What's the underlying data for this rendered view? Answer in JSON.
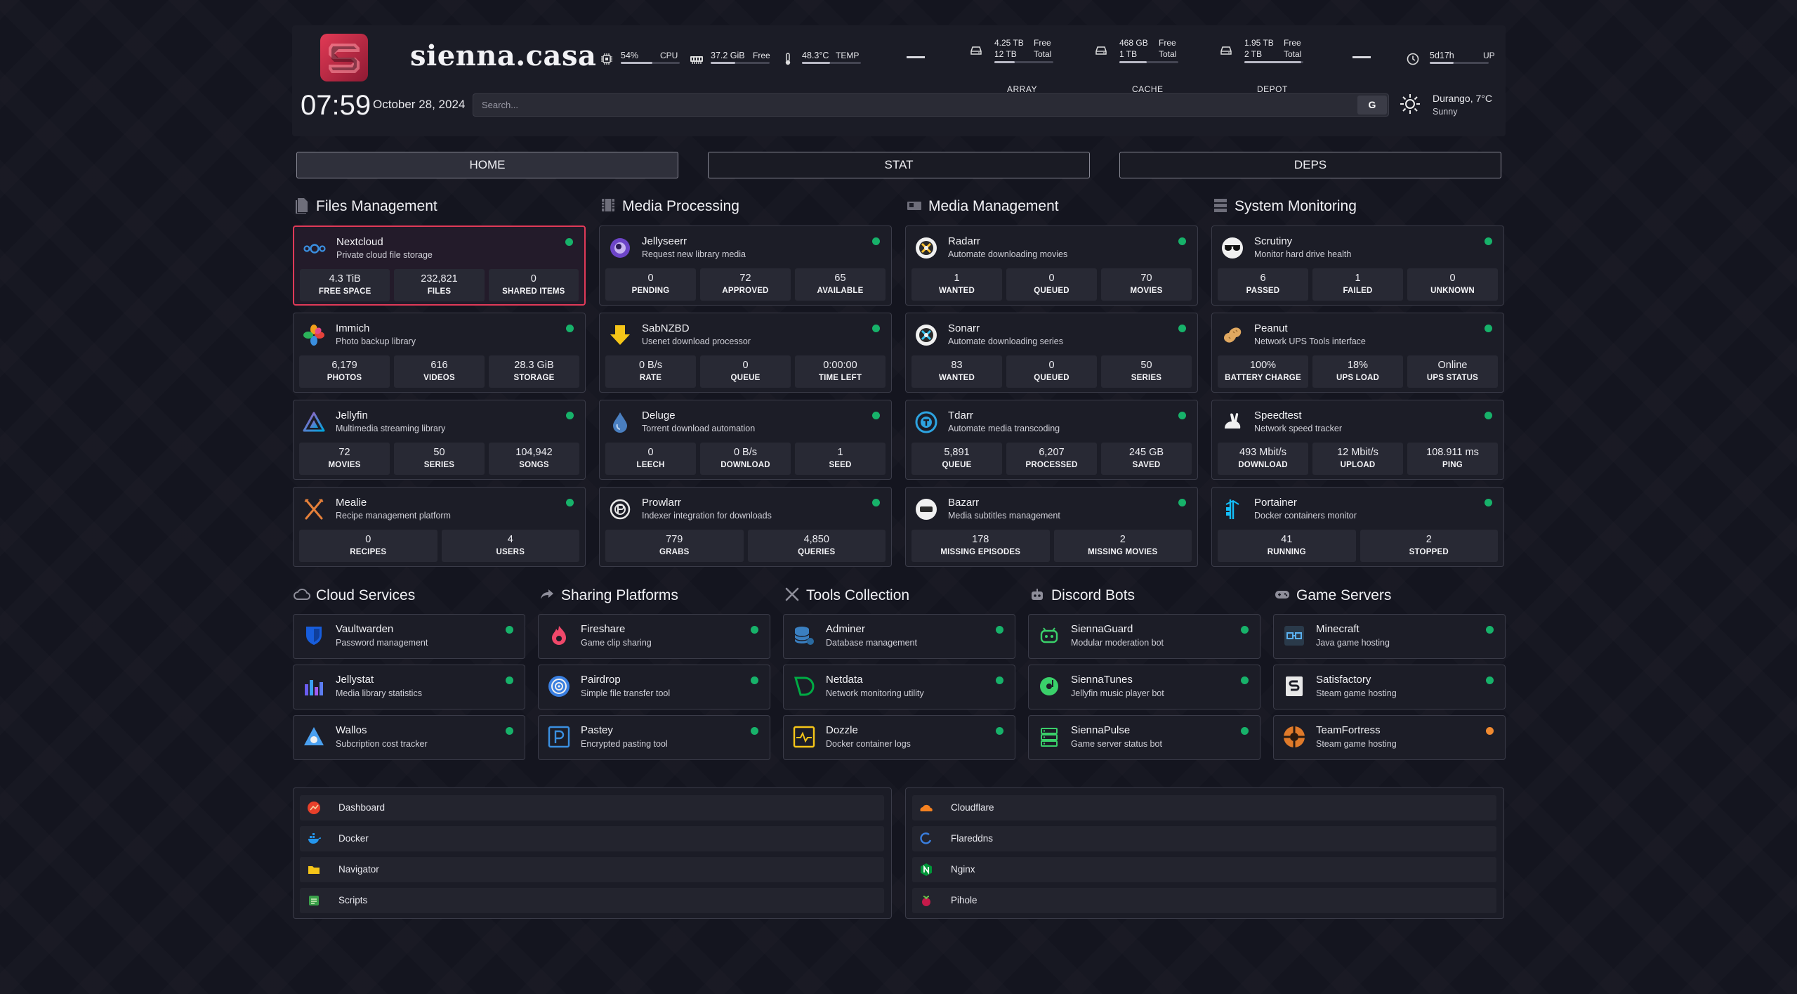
{
  "header": {
    "site_title": "sienna.casa",
    "clock": "07:59",
    "date": "October 28, 2024",
    "search_placeholder": "Search...",
    "search_button": "G",
    "cpu": {
      "value": "54%",
      "label": "CPU",
      "fraction": 0.54
    },
    "memory": {
      "value": "37.2 GiB",
      "label": "Free",
      "fraction": 0.42
    },
    "temp": {
      "value": "48.3°C",
      "label": "TEMP",
      "fraction": 0.48
    },
    "disks": [
      {
        "name": "ARRAY",
        "free": "4.25 TB",
        "free_label": "Free",
        "total": "12 TB",
        "total_label": "Total",
        "fraction": 0.35
      },
      {
        "name": "CACHE",
        "free": "468 GB",
        "free_label": "Free",
        "total": "1 TB",
        "total_label": "Total",
        "fraction": 0.47
      },
      {
        "name": "DEPOT",
        "free": "1.95 TB",
        "free_label": "Free",
        "total": "2 TB",
        "total_label": "Total",
        "fraction": 0.97
      }
    ],
    "uptime": {
      "value": "5d17h",
      "label": "UP",
      "fraction": 0.4
    },
    "weather": {
      "location": "Durango, 7°C",
      "condition": "Sunny"
    }
  },
  "tabs": [
    "HOME",
    "STAT",
    "DEPS"
  ],
  "active_tab": "HOME",
  "sections": {
    "files": "Files Management",
    "media_processing": "Media Processing",
    "media_management": "Media Management",
    "system_monitoring": "System Monitoring",
    "cloud": "Cloud Services",
    "sharing": "Sharing Platforms",
    "tools": "Tools Collection",
    "discord": "Discord Bots",
    "games": "Game Servers"
  },
  "services": {
    "nextcloud": {
      "name": "Nextcloud",
      "desc": "Private cloud file storage",
      "stats": [
        {
          "v": "4.3 TiB",
          "l": "FREE SPACE"
        },
        {
          "v": "232,821",
          "l": "FILES"
        },
        {
          "v": "0",
          "l": "SHARED ITEMS"
        }
      ]
    },
    "immich": {
      "name": "Immich",
      "desc": "Photo backup library",
      "stats": [
        {
          "v": "6,179",
          "l": "PHOTOS"
        },
        {
          "v": "616",
          "l": "VIDEOS"
        },
        {
          "v": "28.3 GiB",
          "l": "STORAGE"
        }
      ]
    },
    "jellyfin": {
      "name": "Jellyfin",
      "desc": "Multimedia streaming library",
      "stats": [
        {
          "v": "72",
          "l": "MOVIES"
        },
        {
          "v": "50",
          "l": "SERIES"
        },
        {
          "v": "104,942",
          "l": "SONGS"
        }
      ]
    },
    "mealie": {
      "name": "Mealie",
      "desc": "Recipe management platform",
      "stats": [
        {
          "v": "0",
          "l": "RECIPES"
        },
        {
          "v": "4",
          "l": "USERS"
        }
      ]
    },
    "jellyseerr": {
      "name": "Jellyseerr",
      "desc": "Request new library media",
      "stats": [
        {
          "v": "0",
          "l": "PENDING"
        },
        {
          "v": "72",
          "l": "APPROVED"
        },
        {
          "v": "65",
          "l": "AVAILABLE"
        }
      ]
    },
    "sabnzbd": {
      "name": "SabNZBD",
      "desc": "Usenet download processor",
      "stats": [
        {
          "v": "0 B/s",
          "l": "RATE"
        },
        {
          "v": "0",
          "l": "QUEUE"
        },
        {
          "v": "0:00:00",
          "l": "TIME LEFT"
        }
      ]
    },
    "deluge": {
      "name": "Deluge",
      "desc": "Torrent download automation",
      "stats": [
        {
          "v": "0",
          "l": "LEECH"
        },
        {
          "v": "0 B/s",
          "l": "DOWNLOAD"
        },
        {
          "v": "1",
          "l": "SEED"
        }
      ]
    },
    "prowlarr": {
      "name": "Prowlarr",
      "desc": "Indexer integration for downloads",
      "stats": [
        {
          "v": "779",
          "l": "GRABS"
        },
        {
          "v": "4,850",
          "l": "QUERIES"
        }
      ]
    },
    "radarr": {
      "name": "Radarr",
      "desc": "Automate downloading movies",
      "stats": [
        {
          "v": "1",
          "l": "WANTED"
        },
        {
          "v": "0",
          "l": "QUEUED"
        },
        {
          "v": "70",
          "l": "MOVIES"
        }
      ]
    },
    "sonarr": {
      "name": "Sonarr",
      "desc": "Automate downloading series",
      "stats": [
        {
          "v": "83",
          "l": "WANTED"
        },
        {
          "v": "0",
          "l": "QUEUED"
        },
        {
          "v": "50",
          "l": "SERIES"
        }
      ]
    },
    "tdarr": {
      "name": "Tdarr",
      "desc": "Automate media transcoding",
      "stats": [
        {
          "v": "5,891",
          "l": "QUEUE"
        },
        {
          "v": "6,207",
          "l": "PROCESSED"
        },
        {
          "v": "245 GB",
          "l": "SAVED"
        }
      ]
    },
    "bazarr": {
      "name": "Bazarr",
      "desc": "Media subtitles management",
      "stats": [
        {
          "v": "178",
          "l": "MISSING EPISODES"
        },
        {
          "v": "2",
          "l": "MISSING MOVIES"
        }
      ]
    },
    "scrutiny": {
      "name": "Scrutiny",
      "desc": "Monitor hard drive health",
      "stats": [
        {
          "v": "6",
          "l": "PASSED"
        },
        {
          "v": "1",
          "l": "FAILED"
        },
        {
          "v": "0",
          "l": "UNKNOWN"
        }
      ]
    },
    "peanut": {
      "name": "Peanut",
      "desc": "Network UPS Tools interface",
      "stats": [
        {
          "v": "100%",
          "l": "BATTERY CHARGE"
        },
        {
          "v": "18%",
          "l": "UPS LOAD"
        },
        {
          "v": "Online",
          "l": "UPS STATUS"
        }
      ]
    },
    "speedtest": {
      "name": "Speedtest",
      "desc": "Network speed tracker",
      "stats": [
        {
          "v": "493 Mbit/s",
          "l": "DOWNLOAD"
        },
        {
          "v": "12 Mbit/s",
          "l": "UPLOAD"
        },
        {
          "v": "108.911 ms",
          "l": "PING"
        }
      ]
    },
    "portainer": {
      "name": "Portainer",
      "desc": "Docker containers monitor",
      "stats": [
        {
          "v": "41",
          "l": "RUNNING"
        },
        {
          "v": "2",
          "l": "STOPPED"
        }
      ]
    }
  },
  "small": {
    "vaultwarden": {
      "name": "Vaultwarden",
      "desc": "Password management"
    },
    "jellystat": {
      "name": "Jellystat",
      "desc": "Media library statistics"
    },
    "wallos": {
      "name": "Wallos",
      "desc": "Subcription cost tracker"
    },
    "fireshare": {
      "name": "Fireshare",
      "desc": "Game clip sharing"
    },
    "pairdrop": {
      "name": "Pairdrop",
      "desc": "Simple file transfer tool"
    },
    "pastey": {
      "name": "Pastey",
      "desc": "Encrypted pasting tool"
    },
    "adminer": {
      "name": "Adminer",
      "desc": "Database management"
    },
    "netdata": {
      "name": "Netdata",
      "desc": "Network monitoring utility"
    },
    "dozzle": {
      "name": "Dozzle",
      "desc": "Docker container logs"
    },
    "siennaguard": {
      "name": "SiennaGuard",
      "desc": "Modular moderation bot"
    },
    "siennatunes": {
      "name": "SiennaTunes",
      "desc": "Jellyfin music player bot"
    },
    "siennapulse": {
      "name": "SiennaPulse",
      "desc": "Game server status bot"
    },
    "minecraft": {
      "name": "Minecraft",
      "desc": "Java game hosting"
    },
    "satisfactory": {
      "name": "Satisfactory",
      "desc": "Steam game hosting"
    },
    "teamfortress": {
      "name": "TeamFortress",
      "desc": "Steam game hosting"
    }
  },
  "bookmarks_left": [
    "Dashboard",
    "Docker",
    "Navigator",
    "Scripts"
  ],
  "bookmarks_right": [
    "Cloudflare",
    "Flareddns",
    "Nginx",
    "Pihole"
  ],
  "colors": {
    "accent": "#e03a58",
    "status_ok": "#17b26a",
    "status_warn": "#f08a30",
    "background": "#14151f",
    "card": "#1c1d27"
  }
}
